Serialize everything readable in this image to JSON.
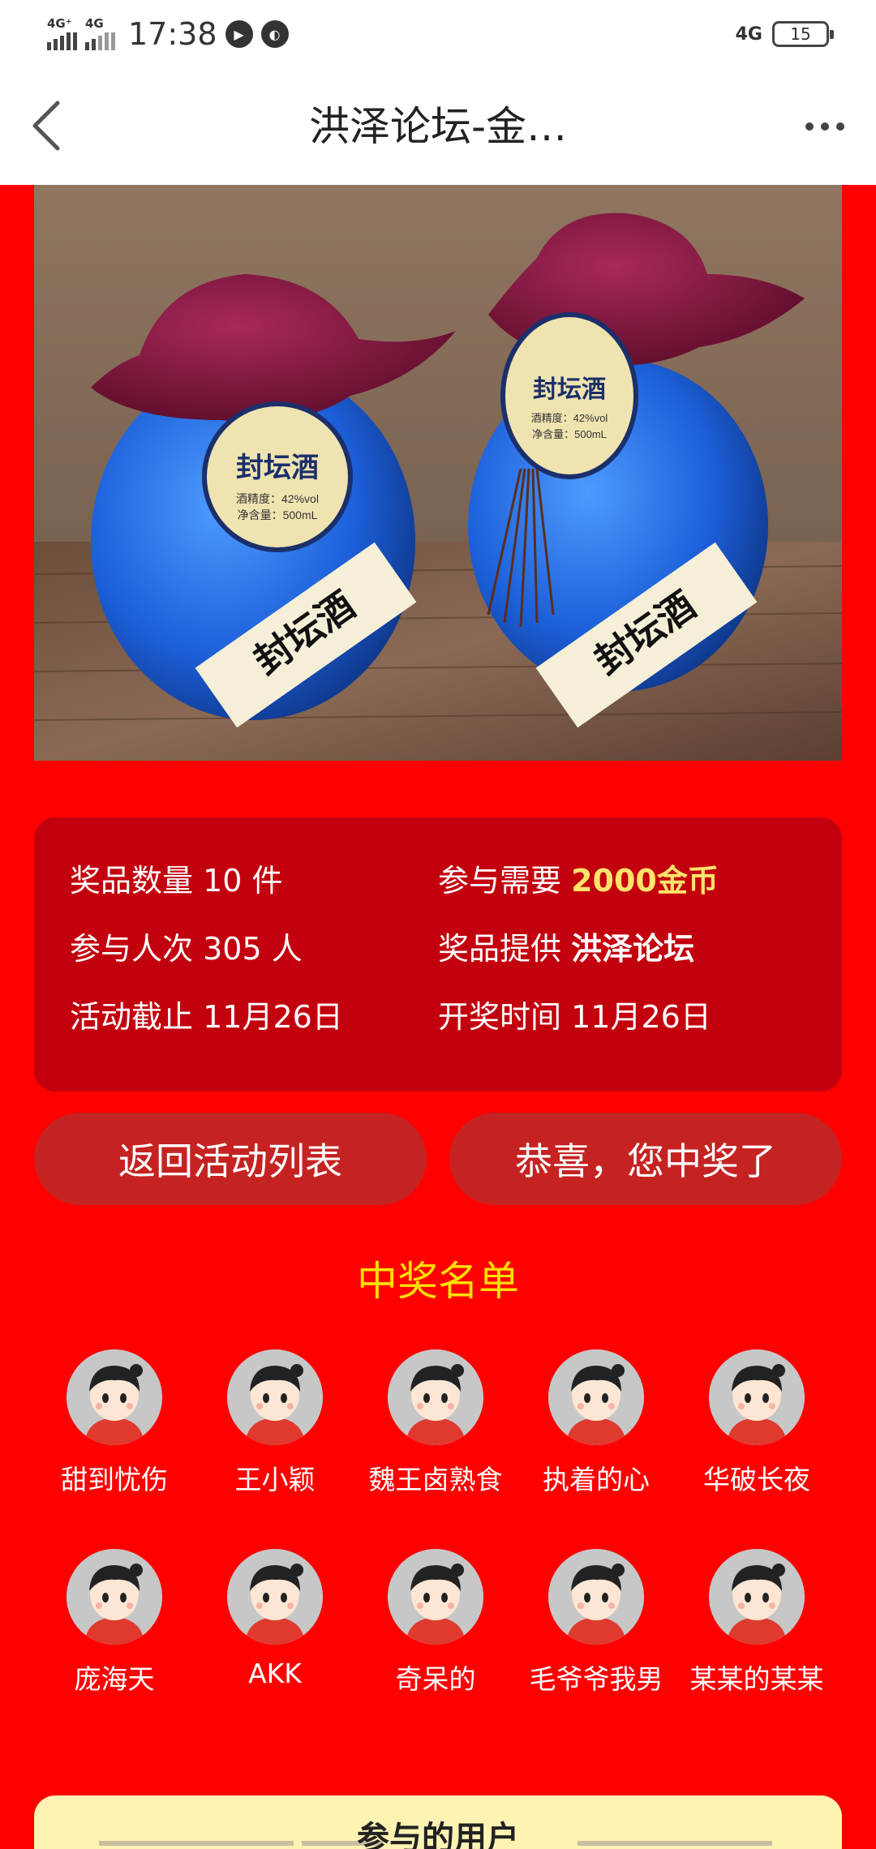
{
  "status_bar": {
    "signal1_label": "4G⁺",
    "signal2_label": "4G",
    "time": "17:38",
    "network": "4G",
    "battery": "15"
  },
  "nav": {
    "title": "洪泽论坛-金…",
    "back_icon": "chevron-left-icon",
    "more_icon": "more-dots-icon"
  },
  "product": {
    "label_brand": "封坛酒",
    "label_abv": "酒精度：42%vol",
    "label_volume": "净含量：500mL",
    "label_band": "封坛酒"
  },
  "info": {
    "prize_count_label": "奖品数量",
    "prize_count_value": "10 件",
    "cost_label": "参与需要",
    "cost_value": "2000金币",
    "participants_label": "参与人次",
    "participants_value": "305 人",
    "provider_label": "奖品提供",
    "provider_value": "洪泽论坛",
    "deadline_label": "活动截止",
    "deadline_value": "11月26日",
    "draw_label": "开奖时间",
    "draw_value": "11月26日"
  },
  "buttons": {
    "back_to_list": "返回活动列表",
    "won": "恭喜，您中奖了"
  },
  "winners_title": "中奖名单",
  "winners": [
    "甜到忧伤",
    "王小颖",
    "魏王卤熟食",
    "执着的心",
    "华破长夜",
    "庞海天",
    "AKK",
    "奇呆的",
    "毛爷爷我男",
    "某某的某某"
  ],
  "participants_title": "参与的用户",
  "colors": {
    "page_bg": "#fe0000",
    "card_bg": "#c3000e",
    "button_bg": "#c52322",
    "gold": "#ffe36b",
    "title_yellow": "#ffe000"
  }
}
